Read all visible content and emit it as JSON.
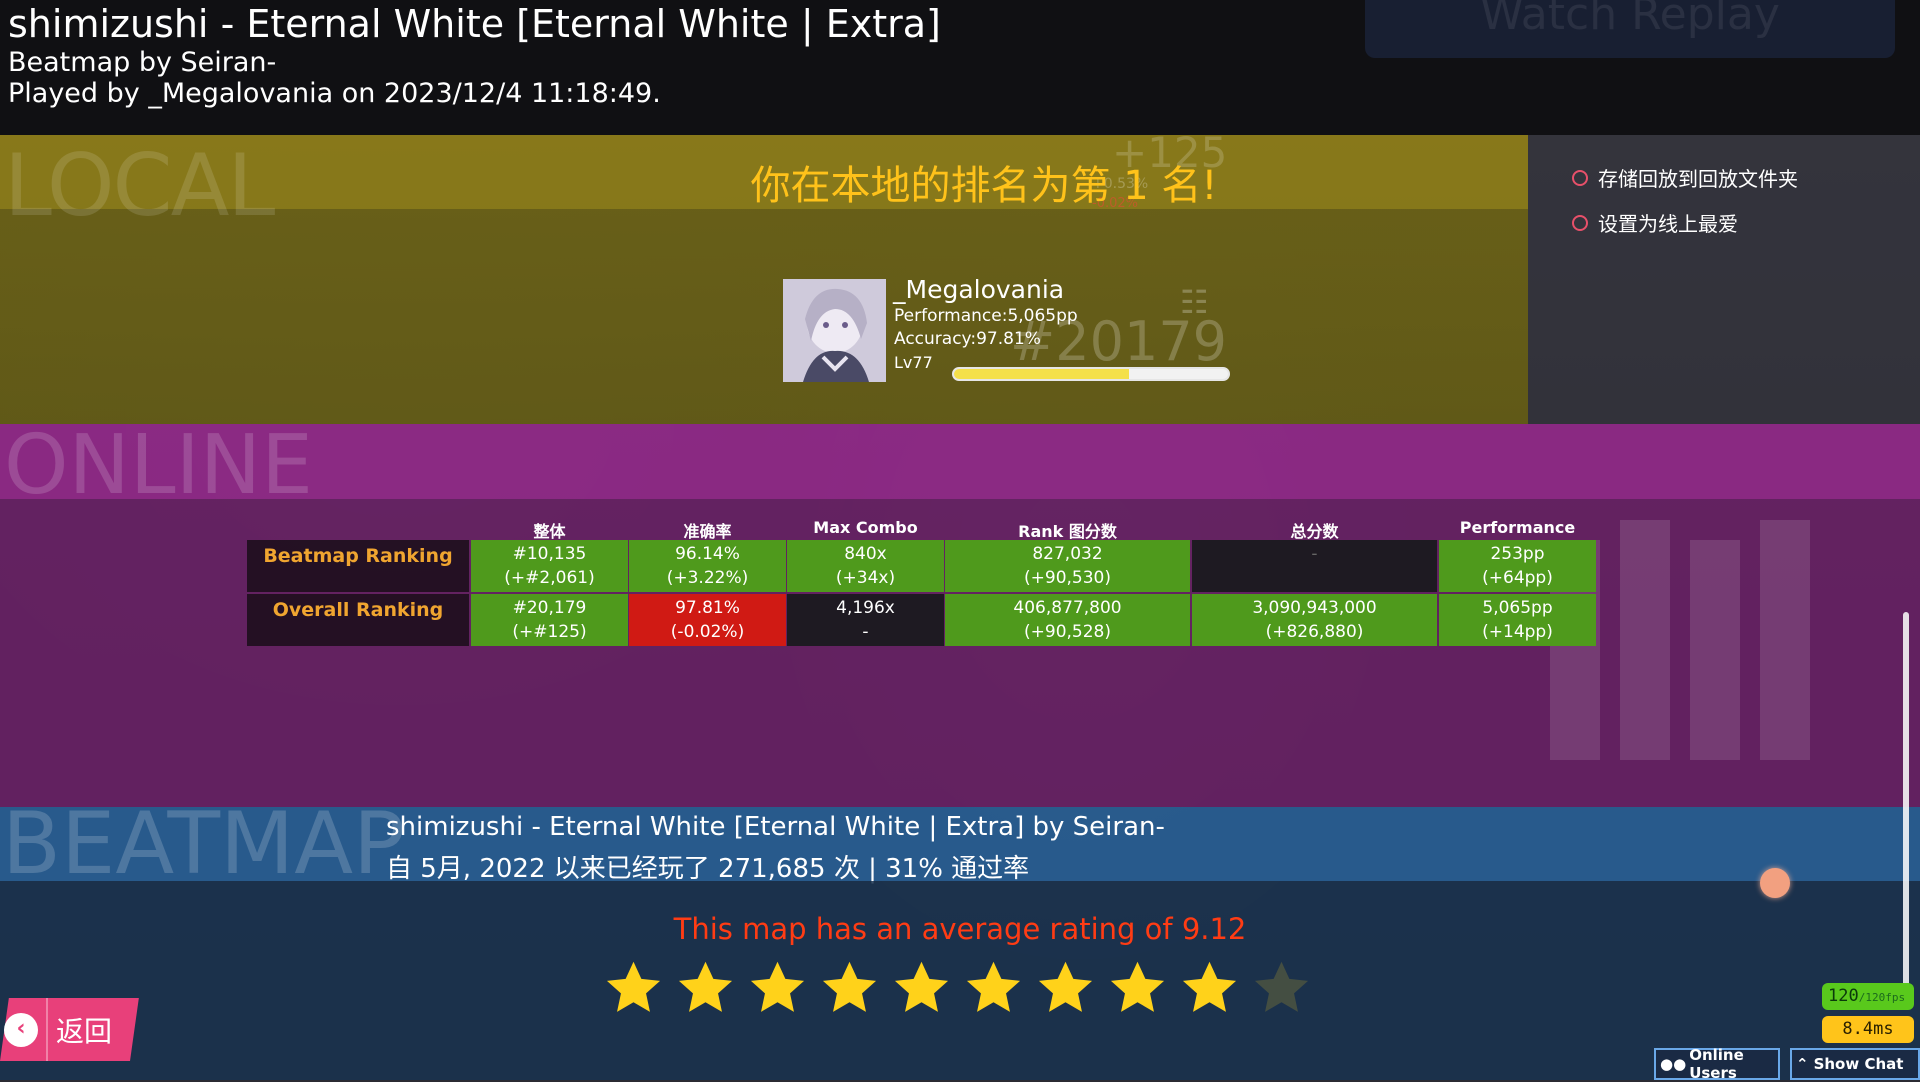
{
  "header": {
    "song_title": "shimizushi - Eternal White [Eternal White | Extra]",
    "mapper_line": "Beatmap by Seiran-",
    "played_line": "Played by _Megalovania on 2023/12/4 11:18:49.",
    "watch_replay_label": "Watch Replay"
  },
  "local": {
    "watermark": "LOCAL",
    "rank_text": "你在本地的排名为第 1 名!",
    "score_delta": "+125",
    "score_delta_small": "+0.53%",
    "score_delta_red": "-0.02%",
    "player": {
      "name": "_Megalovania",
      "performance": "Performance:5,065pp",
      "accuracy": "Accuracy:97.81%",
      "level": "Lv77",
      "global_rank": "#20179",
      "level_progress": 0.64
    }
  },
  "options": {
    "save_replay": "存储回放到回放文件夹",
    "set_favourite": "设置为线上最爱"
  },
  "online": {
    "watermark": "ONLINE",
    "columns": [
      "整体",
      "准确率",
      "Max Combo",
      "Rank 图分数",
      "总分数",
      "Performance"
    ],
    "rows": [
      {
        "label": "Beatmap Ranking",
        "cells": [
          {
            "value": "#10,135",
            "delta": "(+#2,061)",
            "state": "green"
          },
          {
            "value": "96.14%",
            "delta": "(+3.22%)",
            "state": "green"
          },
          {
            "value": "840x",
            "delta": "(+34x)",
            "state": "green"
          },
          {
            "value": "827,032",
            "delta": "(+90,530)",
            "state": "green"
          },
          {
            "value": "-",
            "delta": "",
            "state": "dark"
          },
          {
            "value": "253pp",
            "delta": "(+64pp)",
            "state": "green"
          }
        ]
      },
      {
        "label": "Overall Ranking",
        "cells": [
          {
            "value": "#20,179",
            "delta": "(+#125)",
            "state": "green"
          },
          {
            "value": "97.81%",
            "delta": "(-0.02%)",
            "state": "red"
          },
          {
            "value": "4,196x",
            "delta": "-",
            "state": "dark"
          },
          {
            "value": "406,877,800",
            "delta": "(+90,528)",
            "state": "green"
          },
          {
            "value": "3,090,943,000",
            "delta": "(+826,880)",
            "state": "green"
          },
          {
            "value": "5,065pp",
            "delta": "(+14pp)",
            "state": "green"
          }
        ]
      }
    ]
  },
  "beatmap": {
    "watermark": "BEATMAP",
    "title": "shimizushi - Eternal White [Eternal White | Extra] by Seiran-",
    "stats": "自 5月, 2022 以来已经玩了 271,685 次 | 31% 通过率",
    "rating_text": "This map has an average rating of 9.12",
    "stars_filled": 9,
    "stars_total": 10
  },
  "footer": {
    "back_label": "返回",
    "fps": "120",
    "fps_suffix": "/120fps",
    "frametime": "8.4ms",
    "online_users": "Online Users",
    "show_chat": "Show Chat"
  },
  "colors": {
    "accent_pink": "#e8407a",
    "rank_gold": "#ffc21a",
    "rating_red": "#ff3c14",
    "cell_green": "#4f9a1c",
    "cell_red": "#d01a14"
  }
}
